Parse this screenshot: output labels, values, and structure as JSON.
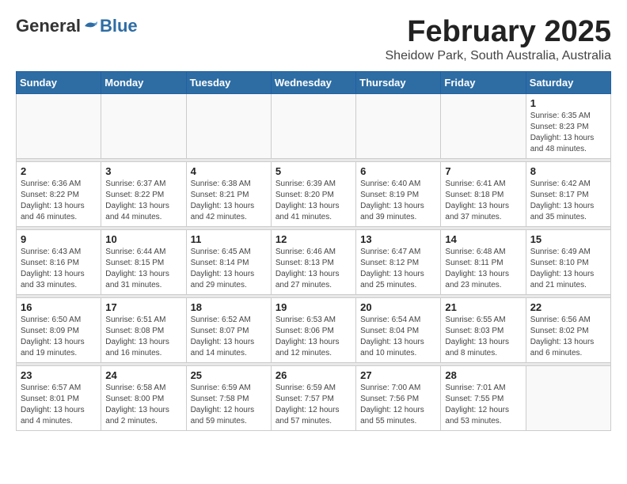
{
  "header": {
    "logo_general": "General",
    "logo_blue": "Blue",
    "month_title": "February 2025",
    "location": "Sheidow Park, South Australia, Australia"
  },
  "columns": [
    "Sunday",
    "Monday",
    "Tuesday",
    "Wednesday",
    "Thursday",
    "Friday",
    "Saturday"
  ],
  "weeks": [
    {
      "days": [
        {
          "num": "",
          "info": ""
        },
        {
          "num": "",
          "info": ""
        },
        {
          "num": "",
          "info": ""
        },
        {
          "num": "",
          "info": ""
        },
        {
          "num": "",
          "info": ""
        },
        {
          "num": "",
          "info": ""
        },
        {
          "num": "1",
          "info": "Sunrise: 6:35 AM\nSunset: 8:23 PM\nDaylight: 13 hours and 48 minutes."
        }
      ]
    },
    {
      "days": [
        {
          "num": "2",
          "info": "Sunrise: 6:36 AM\nSunset: 8:22 PM\nDaylight: 13 hours and 46 minutes."
        },
        {
          "num": "3",
          "info": "Sunrise: 6:37 AM\nSunset: 8:22 PM\nDaylight: 13 hours and 44 minutes."
        },
        {
          "num": "4",
          "info": "Sunrise: 6:38 AM\nSunset: 8:21 PM\nDaylight: 13 hours and 42 minutes."
        },
        {
          "num": "5",
          "info": "Sunrise: 6:39 AM\nSunset: 8:20 PM\nDaylight: 13 hours and 41 minutes."
        },
        {
          "num": "6",
          "info": "Sunrise: 6:40 AM\nSunset: 8:19 PM\nDaylight: 13 hours and 39 minutes."
        },
        {
          "num": "7",
          "info": "Sunrise: 6:41 AM\nSunset: 8:18 PM\nDaylight: 13 hours and 37 minutes."
        },
        {
          "num": "8",
          "info": "Sunrise: 6:42 AM\nSunset: 8:17 PM\nDaylight: 13 hours and 35 minutes."
        }
      ]
    },
    {
      "days": [
        {
          "num": "9",
          "info": "Sunrise: 6:43 AM\nSunset: 8:16 PM\nDaylight: 13 hours and 33 minutes."
        },
        {
          "num": "10",
          "info": "Sunrise: 6:44 AM\nSunset: 8:15 PM\nDaylight: 13 hours and 31 minutes."
        },
        {
          "num": "11",
          "info": "Sunrise: 6:45 AM\nSunset: 8:14 PM\nDaylight: 13 hours and 29 minutes."
        },
        {
          "num": "12",
          "info": "Sunrise: 6:46 AM\nSunset: 8:13 PM\nDaylight: 13 hours and 27 minutes."
        },
        {
          "num": "13",
          "info": "Sunrise: 6:47 AM\nSunset: 8:12 PM\nDaylight: 13 hours and 25 minutes."
        },
        {
          "num": "14",
          "info": "Sunrise: 6:48 AM\nSunset: 8:11 PM\nDaylight: 13 hours and 23 minutes."
        },
        {
          "num": "15",
          "info": "Sunrise: 6:49 AM\nSunset: 8:10 PM\nDaylight: 13 hours and 21 minutes."
        }
      ]
    },
    {
      "days": [
        {
          "num": "16",
          "info": "Sunrise: 6:50 AM\nSunset: 8:09 PM\nDaylight: 13 hours and 19 minutes."
        },
        {
          "num": "17",
          "info": "Sunrise: 6:51 AM\nSunset: 8:08 PM\nDaylight: 13 hours and 16 minutes."
        },
        {
          "num": "18",
          "info": "Sunrise: 6:52 AM\nSunset: 8:07 PM\nDaylight: 13 hours and 14 minutes."
        },
        {
          "num": "19",
          "info": "Sunrise: 6:53 AM\nSunset: 8:06 PM\nDaylight: 13 hours and 12 minutes."
        },
        {
          "num": "20",
          "info": "Sunrise: 6:54 AM\nSunset: 8:04 PM\nDaylight: 13 hours and 10 minutes."
        },
        {
          "num": "21",
          "info": "Sunrise: 6:55 AM\nSunset: 8:03 PM\nDaylight: 13 hours and 8 minutes."
        },
        {
          "num": "22",
          "info": "Sunrise: 6:56 AM\nSunset: 8:02 PM\nDaylight: 13 hours and 6 minutes."
        }
      ]
    },
    {
      "days": [
        {
          "num": "23",
          "info": "Sunrise: 6:57 AM\nSunset: 8:01 PM\nDaylight: 13 hours and 4 minutes."
        },
        {
          "num": "24",
          "info": "Sunrise: 6:58 AM\nSunset: 8:00 PM\nDaylight: 13 hours and 2 minutes."
        },
        {
          "num": "25",
          "info": "Sunrise: 6:59 AM\nSunset: 7:58 PM\nDaylight: 12 hours and 59 minutes."
        },
        {
          "num": "26",
          "info": "Sunrise: 6:59 AM\nSunset: 7:57 PM\nDaylight: 12 hours and 57 minutes."
        },
        {
          "num": "27",
          "info": "Sunrise: 7:00 AM\nSunset: 7:56 PM\nDaylight: 12 hours and 55 minutes."
        },
        {
          "num": "28",
          "info": "Sunrise: 7:01 AM\nSunset: 7:55 PM\nDaylight: 12 hours and 53 minutes."
        },
        {
          "num": "",
          "info": ""
        }
      ]
    }
  ]
}
